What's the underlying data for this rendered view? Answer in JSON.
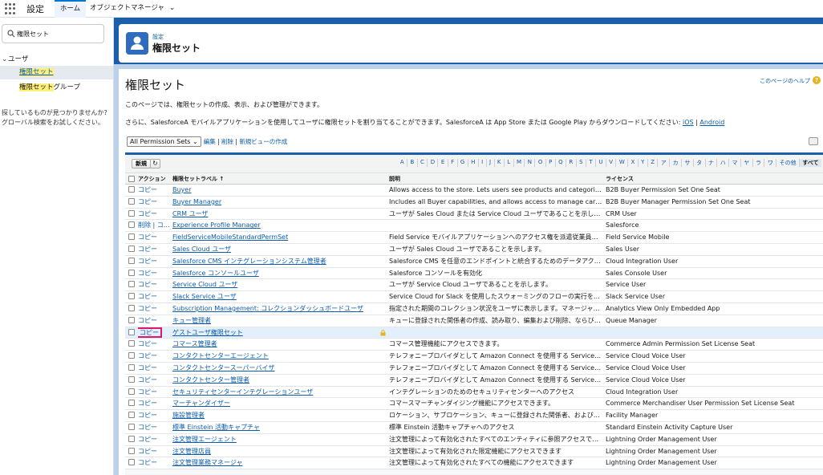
{
  "topbar": {
    "app_name": "設定",
    "tabs": [
      {
        "label": "ホーム"
      },
      {
        "label": "オブジェクトマネージャ"
      }
    ]
  },
  "sidebar": {
    "quickfind_value": "権限セット",
    "group_label": "ユーザ",
    "items": [
      {
        "label": "権限セット"
      },
      {
        "label": "権限セット",
        "suffix": "グループ"
      }
    ],
    "help_text": "探しているものが見つかりませんか? グローバル検索をお試しください。"
  },
  "header": {
    "subtitle": "設定",
    "title": "権限セット"
  },
  "main": {
    "title": "権限セット",
    "help_link": "このページのヘルプ",
    "desc1": "このページでは、権限セットの作成、表示、および管理ができます。",
    "desc2_prefix": "さらに、SalesforceA モバイルアプリケーションを使用してユーザに権限セットを割り当てることができます。SalesforceA は App Store または Google Play からダウンロードしてください: ",
    "desc2_ios": "iOS",
    "desc2_sep": " | ",
    "desc2_android": "Android",
    "view_select": "All Permission Sets",
    "view_links": {
      "edit": "編集",
      "sep1": " | ",
      "delete": "削除",
      "sep2": " | ",
      "new_view": "新規ビューの作成"
    },
    "new_button": "新規",
    "alphabet": [
      "A",
      "B",
      "C",
      "D",
      "E",
      "F",
      "G",
      "H",
      "I",
      "J",
      "K",
      "L",
      "M",
      "N",
      "O",
      "P",
      "Q",
      "R",
      "S",
      "T",
      "U",
      "V",
      "W",
      "X",
      "Y",
      "Z",
      "ア",
      "カ",
      "サ",
      "タ",
      "ナ",
      "ハ",
      "マ",
      "ヤ",
      "ラ",
      "ワ",
      "その他",
      "すべて"
    ],
    "alphabet_selected": "すべて",
    "columns": {
      "action": "アクション",
      "label": "権限セットラベル ↑",
      "description": "説明",
      "license": "ライセンス"
    },
    "rows": [
      {
        "action": "コピー",
        "label": "Buyer",
        "description": "Allows access to the store. Lets users see products and categories, make pu…",
        "license": "B2B Buyer Permission Set One Seat"
      },
      {
        "action": "コピー",
        "label": "Buyer Manager",
        "description": "Includes all Buyer capabilities, and allows access to manage carts and orders…",
        "license": "B2B Buyer Manager Permission Set One Seat"
      },
      {
        "action": "コピー",
        "label": "CRM ユーザ",
        "description": "ユーザが Sales Cloud または Service Cloud ユーザであることを示します。",
        "license": "CRM User"
      },
      {
        "action": "削除 | コ…",
        "label": "Experience Profile Manager",
        "description": "",
        "license": "Salesforce"
      },
      {
        "action": "コピー",
        "label": "FieldServiceMobileStandardPermSet",
        "description": "Field Service モバイルアプリケーションへのアクセス権を派遣従業員に許可します。…",
        "license": "Field Service Mobile"
      },
      {
        "action": "コピー",
        "label": "Sales Cloud ユーザ",
        "description": "ユーザが Sales Cloud ユーザであることを示します。",
        "license": "Sales User"
      },
      {
        "action": "コピー",
        "label": "Salesforce CMS インテグレーションシステム管理者",
        "description": "Salesforce CMS を任意のエンドポイントと統合するためのデータアクセス権と権限…",
        "license": "Cloud Integration User"
      },
      {
        "action": "コピー",
        "label": "Salesforce コンソールユーザ",
        "description": "Salesforce コンソールを有効化",
        "license": "Sales Console User"
      },
      {
        "action": "コピー",
        "label": "Service Cloud ユーザ",
        "description": "ユーザが Service Cloud ユーザであることを示します。",
        "license": "Service User"
      },
      {
        "action": "コピー",
        "label": "Slack Service ユーザ",
        "description": "Service Cloud for Slack を使用したスウォーミングのフローの実行をユーザに許可…",
        "license": "Slack Service User"
      },
      {
        "action": "コピー",
        "label": "Subscription Management: コレクションダッシュボードユーザ",
        "description": "指定された期間のコレクション状況をユーザに表示します。マネージャとエージェン…",
        "license": "Analytics View Only Embedded App"
      },
      {
        "action": "コピー",
        "label": "キュー管理者",
        "description": "キューに登録された関係者の作成、読み取り、編集および削除、ならびにキューの読…",
        "license": "Queue Manager"
      },
      {
        "action": "コピー",
        "label": "ゲストユーザ権限セット",
        "description": "",
        "license": ""
      },
      {
        "action": "コピー",
        "label": "コマース管理者",
        "description": "コマース管理機能にアクセスできます。",
        "license": "Commerce Admin Permission Set License Seat"
      },
      {
        "action": "コピー",
        "label": "コンタクトセンターエージェント",
        "description": "テレフォニープロバイダとして Amazon Connect を使用する Service Cloud Voice …",
        "license": "Service Cloud Voice User"
      },
      {
        "action": "コピー",
        "label": "コンタクトセンタースーパーバイザ",
        "description": "テレフォニープロバイダとして Amazon Connect を使用する Service Cloud Voice …",
        "license": "Service Cloud Voice User"
      },
      {
        "action": "コピー",
        "label": "コンタクトセンター管理者",
        "description": "テレフォニープロバイダとして Amazon Connect を使用する Service Cloud Voice …",
        "license": "Service Cloud Voice User"
      },
      {
        "action": "コピー",
        "label": "セキュリティセンターインテグレーションユーザ",
        "description": "インテグレーションのためのセキュリティセンターへのアクセス",
        "license": "Cloud Integration User"
      },
      {
        "action": "コピー",
        "label": "マーチャンダイザー",
        "description": "コマースマーチャンダイジング機能にアクセスできます。",
        "license": "Commerce Merchandiser User Permission Set License Seat"
      },
      {
        "action": "コピー",
        "label": "施設管理者",
        "description": "ロケーション、サブロケーション、キューに登録された関係者、およびキューの作成…",
        "license": "Facility Manager"
      },
      {
        "action": "コピー",
        "label": "標準 Einstein 活動キャプチャ",
        "description": "標準 Einstein 活動キャプチャへのアクセス",
        "license": "Standard Einstein Activity Capture User"
      },
      {
        "action": "コピー",
        "label": "注文管理エージェント",
        "description": "注文管理によって有効化されたすべてのエンティティに参照アクセスできます",
        "license": "Lightning Order Management User"
      },
      {
        "action": "コピー",
        "label": "注文管理店員",
        "description": "注文管理によって有効化された限定機能にアクセスできます",
        "license": "Lightning Order Management User"
      },
      {
        "action": "コピー",
        "label": "注文管理業務マネージャ",
        "description": "注文管理によって有効化されたすべての機能にアクセスできます",
        "license": "Lightning Order Management User"
      }
    ]
  },
  "colors": {
    "accent": "#0176d3",
    "brand_band": "#1b5fa8",
    "highlight": "#fff07a",
    "selection_box": "#e0176a"
  }
}
